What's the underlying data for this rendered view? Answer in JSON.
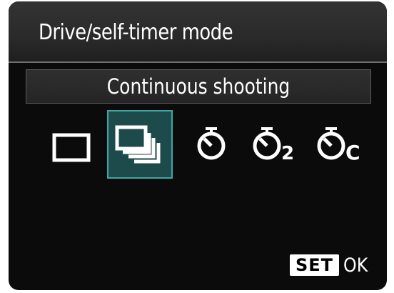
{
  "menu": {
    "title": "Drive/self-timer mode",
    "selected_mode_label": "Continuous shooting"
  },
  "drive_modes": [
    {
      "name": "single-shot-icon",
      "selected": false
    },
    {
      "name": "continuous-shooting-icon",
      "selected": true
    },
    {
      "name": "self-timer-10s-icon",
      "selected": false
    },
    {
      "name": "self-timer-2s-icon",
      "selected": false,
      "suffix": "2"
    },
    {
      "name": "self-timer-continuous-icon",
      "selected": false,
      "suffix": "C"
    }
  ],
  "footer": {
    "set_label": "SET",
    "ok_label": "OK"
  },
  "colors": {
    "selection_bg": "#1d4a4a",
    "selection_border": "#3fa7a7"
  }
}
